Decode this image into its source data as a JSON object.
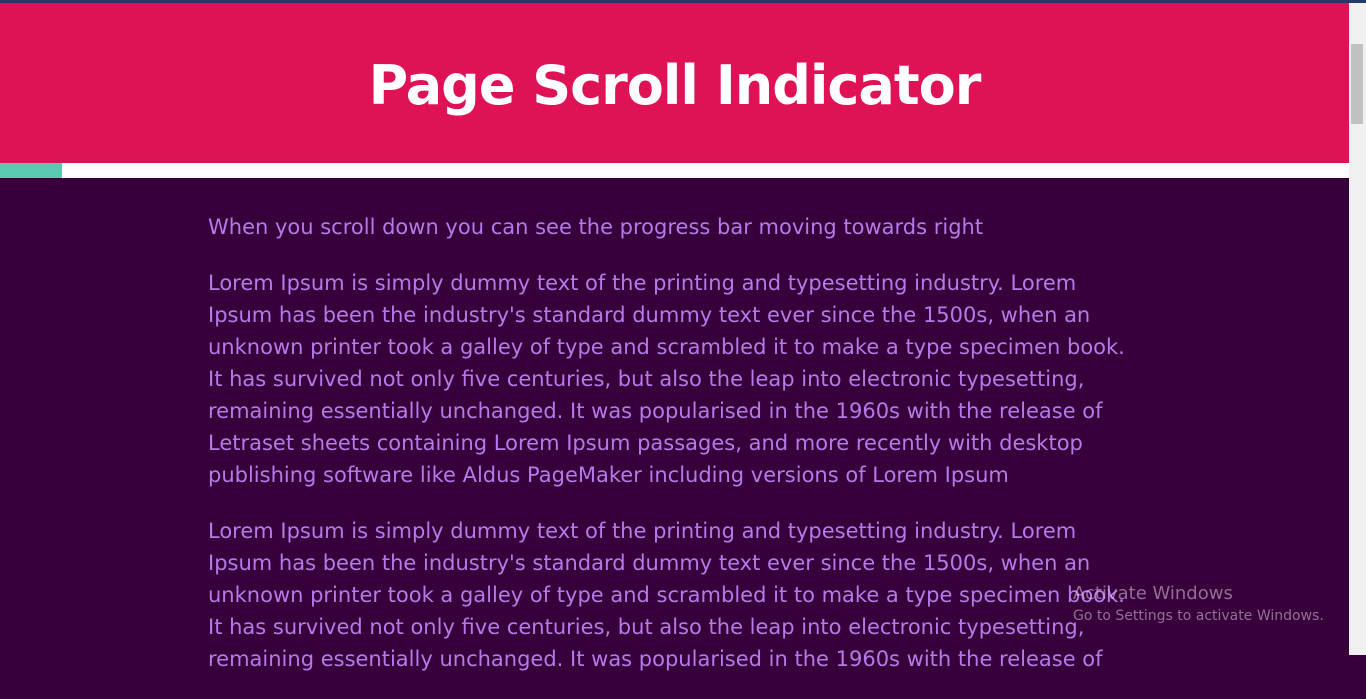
{
  "header": {
    "title": "Page Scroll Indicator"
  },
  "progress": {
    "fraction": 0.046,
    "fill_color": "#5bc9b1",
    "track_color": "#ffffff"
  },
  "colors": {
    "header_bg": "#de1254",
    "page_bg": "#37003a",
    "text": "#b47ae8"
  },
  "content": {
    "paragraphs": [
      "When you scroll down you can see the progress bar moving towards right",
      "Lorem Ipsum is simply dummy text of the printing and typesetting industry. Lorem Ipsum has been the industry's standard dummy text ever since the 1500s, when an unknown printer took a galley of type and scrambled it to make a type specimen book. It has survived not only five centuries, but also the leap into electronic typesetting, remaining essentially unchanged. It was popularised in the 1960s with the release of Letraset sheets containing Lorem Ipsum passages, and more recently with desktop publishing software like Aldus PageMaker including versions of Lorem Ipsum",
      "Lorem Ipsum is simply dummy text of the printing and typesetting industry. Lorem Ipsum has been the industry's standard dummy text ever since the 1500s, when an unknown printer took a galley of type and scrambled it to make a type specimen book. It has survived not only five centuries, but also the leap into electronic typesetting, remaining essentially unchanged. It was popularised in the 1960s with the release of"
    ]
  },
  "watermark": {
    "title": "Activate Windows",
    "subtitle": "Go to Settings to activate Windows."
  }
}
